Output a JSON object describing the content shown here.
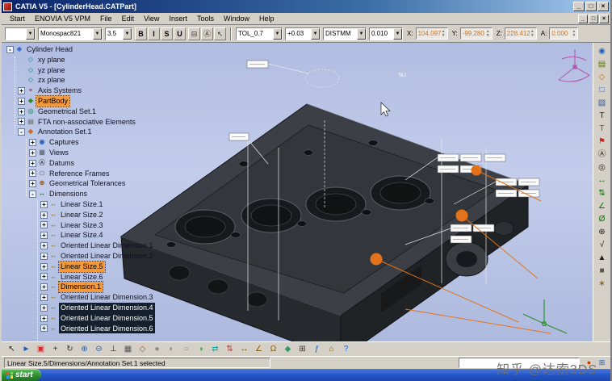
{
  "window": {
    "title": "CATIA V5 - [CylinderHead.CATPart]",
    "controls": {
      "minimize": "_",
      "maximize": "□",
      "close": "×"
    }
  },
  "menubar": {
    "items": [
      "Start",
      "ENOVIA V5 VPM",
      "File",
      "Edit",
      "View",
      "Insert",
      "Tools",
      "Window",
      "Help"
    ]
  },
  "toolbar": {
    "style_value": "",
    "font_value": "Monospac821",
    "size_value": "3.5",
    "format_buttons": [
      {
        "name": "bold-button",
        "label": "B"
      },
      {
        "name": "italic-button",
        "label": "I"
      },
      {
        "name": "strikethrough-button",
        "label": "S"
      },
      {
        "name": "underline-button",
        "label": "U"
      }
    ],
    "icon_buttons": [
      {
        "name": "text-anchor-icon",
        "glyph": "⊟",
        "color": "#333333"
      },
      {
        "name": "text-frame-icon",
        "glyph": "Ⓐ",
        "color": "#333333"
      },
      {
        "name": "leader-symbol-icon",
        "glyph": "↖",
        "color": "#333333"
      }
    ],
    "tolerance_type": "TOL_0.7",
    "tolerance_value": "+0.03",
    "distance_type": "DISTMM",
    "distance_value": "0.010",
    "coords": {
      "x_label": "X:",
      "x_value": "104.097",
      "y_label": "Y:",
      "y_value": "-99.280",
      "z_label": "Z:",
      "z_value": "228.412",
      "a_label": "A:",
      "a_value": "0.000"
    }
  },
  "tree": {
    "icons": {
      "part": {
        "glyph": "◆",
        "color": "#3a6ad4"
      },
      "plane": {
        "glyph": "◇",
        "color": "#18a8b8"
      },
      "axis": {
        "glyph": "⌖",
        "color": "#c03030"
      },
      "partbody": {
        "glyph": "◆",
        "color": "#2e8b2e"
      },
      "geoset": {
        "glyph": "◎",
        "color": "#20a070"
      },
      "fta": {
        "glyph": "▤",
        "color": "#808080"
      },
      "annotation": {
        "glyph": "◆",
        "color": "#d2691e"
      },
      "captures": {
        "glyph": "◉",
        "color": "#2060c0"
      },
      "views": {
        "glyph": "▦",
        "color": "#607080"
      },
      "datums": {
        "glyph": "Ⓐ",
        "color": "#303030"
      },
      "frames": {
        "glyph": "□",
        "color": "#505050"
      },
      "geotol": {
        "glyph": "⊕",
        "color": "#905010"
      },
      "dimensions": {
        "glyph": "↔",
        "color": "#107010"
      },
      "dim": {
        "glyph": "↔",
        "color": "#b08800"
      }
    },
    "items": [
      {
        "label": "Cylinder Head",
        "level": 0,
        "icon": "part",
        "expander": "-",
        "state": null
      },
      {
        "label": "xy plane",
        "level": 1,
        "icon": "plane",
        "expander": null,
        "state": null
      },
      {
        "label": "yz plane",
        "level": 1,
        "icon": "plane",
        "expander": null,
        "state": null
      },
      {
        "label": "zx plane",
        "level": 1,
        "icon": "plane",
        "expander": null,
        "state": null
      },
      {
        "label": "Axis Systems",
        "level": 1,
        "icon": "axis",
        "expander": "+",
        "state": null
      },
      {
        "label": "PartBody",
        "level": 1,
        "icon": "partbody",
        "expander": "+",
        "state": "orange"
      },
      {
        "label": "Geometrical Set.1",
        "level": 1,
        "icon": "geoset",
        "expander": "+",
        "state": null
      },
      {
        "label": "FTA non-associative Elements",
        "level": 1,
        "icon": "fta",
        "expander": "+",
        "state": null
      },
      {
        "label": "Annotation Set.1",
        "level": 1,
        "icon": "annotation",
        "expander": "-",
        "state": null
      },
      {
        "label": "Captures",
        "level": 2,
        "icon": "captures",
        "expander": "+",
        "state": null
      },
      {
        "label": "Views",
        "level": 2,
        "icon": "views",
        "expander": "+",
        "state": null
      },
      {
        "label": "Datums",
        "level": 2,
        "icon": "datums",
        "expander": "+",
        "state": null
      },
      {
        "label": "Reference Frames",
        "level": 2,
        "icon": "frames",
        "expander": "+",
        "state": null
      },
      {
        "label": "Geometrical Tolerances",
        "level": 2,
        "icon": "geotol",
        "expander": "+",
        "state": null
      },
      {
        "label": "Dimensions",
        "level": 2,
        "icon": "dimensions",
        "expander": "-",
        "state": null
      },
      {
        "label": "Linear Size.1",
        "level": 3,
        "icon": "dim",
        "expander": "+",
        "state": null
      },
      {
        "label": "Linear Size.2",
        "level": 3,
        "icon": "dim",
        "expander": "+",
        "state": null
      },
      {
        "label": "Linear Size.3",
        "level": 3,
        "icon": "dim",
        "expander": "+",
        "state": null
      },
      {
        "label": "Linear Size.4",
        "level": 3,
        "icon": "dim",
        "expander": "+",
        "state": null
      },
      {
        "label": "Oriented Linear Dimension.1",
        "level": 3,
        "icon": "dim",
        "expander": "+",
        "state": null
      },
      {
        "label": "Oriented Linear Dimension.2",
        "level": 3,
        "icon": "dim",
        "expander": "+",
        "state": null
      },
      {
        "label": "Linear Size.5",
        "level": 3,
        "icon": "dim",
        "expander": "+",
        "state": "orange"
      },
      {
        "label": "Linear Size.6",
        "level": 3,
        "icon": "dim",
        "expander": "+",
        "state": null
      },
      {
        "label": "Dimension.1",
        "level": 3,
        "icon": "dim",
        "expander": "+",
        "state": "orange"
      },
      {
        "label": "Oriented Linear Dimension.3",
        "level": 3,
        "icon": "dim",
        "expander": "+",
        "state": null
      },
      {
        "label": "Oriented Linear Dimension.4",
        "level": 3,
        "icon": "dim",
        "expander": "+",
        "state": "dark"
      },
      {
        "label": "Oriented Linear Dimension.5",
        "level": 3,
        "icon": "dim",
        "expander": "+",
        "state": "dark"
      },
      {
        "label": "Oriented Linear Dimension.6",
        "level": 3,
        "icon": "dim",
        "expander": "+",
        "state": "dark"
      }
    ]
  },
  "viewport": {
    "annotation_label": "N.I"
  },
  "right_toolbar": {
    "icons": [
      {
        "name": "capture-icon",
        "glyph": "◉",
        "color": "#2060c0"
      },
      {
        "name": "view-list-icon",
        "glyph": "▤",
        "color": "#557700"
      },
      {
        "name": "annotation-plane-icon",
        "glyph": "◇",
        "color": "#cc6600"
      },
      {
        "name": "front-view-icon",
        "glyph": "□",
        "color": "#2060c0"
      },
      {
        "name": "section-view-icon",
        "glyph": "▧",
        "color": "#2060c0"
      },
      {
        "name": "text-icon",
        "glyph": "T",
        "color": "#222222"
      },
      {
        "name": "text-with-leader-icon",
        "glyph": "T",
        "color": "#885500"
      },
      {
        "name": "flag-note-icon",
        "glyph": "⚑",
        "color": "#cc2222"
      },
      {
        "name": "datum-feature-icon",
        "glyph": "Ⓐ",
        "color": "#222222"
      },
      {
        "name": "datum-target-icon",
        "glyph": "◎",
        "color": "#222222"
      },
      {
        "name": "dimension-icon",
        "glyph": "↔",
        "color": "#007700"
      },
      {
        "name": "stacked-dimension-icon",
        "glyph": "⇅",
        "color": "#007700"
      },
      {
        "name": "angle-dimension-icon",
        "glyph": "∠",
        "color": "#007700"
      },
      {
        "name": "diameter-dimension-icon",
        "glyph": "Ø",
        "color": "#007700"
      },
      {
        "name": "geometric-tolerance-icon",
        "glyph": "⊕",
        "color": "#222222"
      },
      {
        "name": "roughness-icon",
        "glyph": "√",
        "color": "#222222"
      },
      {
        "name": "weld-symbol-icon",
        "glyph": "▲",
        "color": "#222222"
      },
      {
        "name": "frame-icon",
        "glyph": "■",
        "color": "#555555"
      },
      {
        "name": "noa-icon",
        "glyph": "∗",
        "color": "#885500"
      }
    ]
  },
  "bottom_toolbar": {
    "icons": [
      {
        "name": "select-icon",
        "glyph": "↖",
        "color": "#222222"
      },
      {
        "name": "fly-mode-icon",
        "glyph": "►",
        "color": "#2060c0"
      },
      {
        "name": "fit-all-icon",
        "glyph": "▣",
        "color": "#cc3333"
      },
      {
        "name": "pan-icon",
        "glyph": "+",
        "color": "#333333"
      },
      {
        "name": "rotate-icon",
        "glyph": "↻",
        "color": "#333333"
      },
      {
        "name": "zoom-in-icon",
        "glyph": "⊕",
        "color": "#2060c0"
      },
      {
        "name": "zoom-out-icon",
        "glyph": "⊖",
        "color": "#2060c0"
      },
      {
        "name": "normal-view-icon",
        "glyph": "⊥",
        "color": "#333333"
      },
      {
        "name": "multi-view-icon",
        "glyph": "▦",
        "color": "#555555"
      },
      {
        "name": "quick-view-icon",
        "glyph": "◇",
        "color": "#aa5500"
      },
      {
        "name": "shading-icon",
        "glyph": "●",
        "color": "#888888"
      },
      {
        "name": "shading-edges-icon",
        "glyph": "◐",
        "color": "#888888"
      },
      {
        "name": "wireframe-icon",
        "glyph": "○",
        "color": "#888888"
      },
      {
        "name": "hide-show-icon",
        "glyph": "◑",
        "color": "#22aa22"
      },
      {
        "name": "swap-space-icon",
        "glyph": "⇄",
        "color": "#00aaaa"
      },
      {
        "name": "update-icon",
        "glyph": "⇅",
        "color": "#cc3333"
      },
      {
        "name": "measure-between-icon",
        "glyph": "↔",
        "color": "#885500"
      },
      {
        "name": "measure-item-icon",
        "glyph": "∠",
        "color": "#885500"
      },
      {
        "name": "mass-properties-icon",
        "glyph": "Ω",
        "color": "#885500"
      },
      {
        "name": "apply-material-icon",
        "glyph": "◆",
        "color": "#339966"
      },
      {
        "name": "graph-icon",
        "glyph": "⊞",
        "color": "#333333"
      },
      {
        "name": "knowledge-icon",
        "glyph": "ƒ",
        "color": "#2060c0"
      },
      {
        "name": "catalog-icon",
        "glyph": "⌂",
        "color": "#885500"
      },
      {
        "name": "help-icon",
        "glyph": "?",
        "color": "#2060c0"
      }
    ]
  },
  "statusbar": {
    "message": "Linear Size.5/Dimensions/Annotation Set.1 selected",
    "icons": [
      {
        "name": "status-alert-icon",
        "glyph": "●",
        "color": "#c04000"
      },
      {
        "name": "status-panel-icon",
        "glyph": "⊞",
        "color": "#2060c0"
      }
    ]
  },
  "taskbar": {
    "start_label": "start"
  },
  "watermark": "知乎 @达索3DS"
}
